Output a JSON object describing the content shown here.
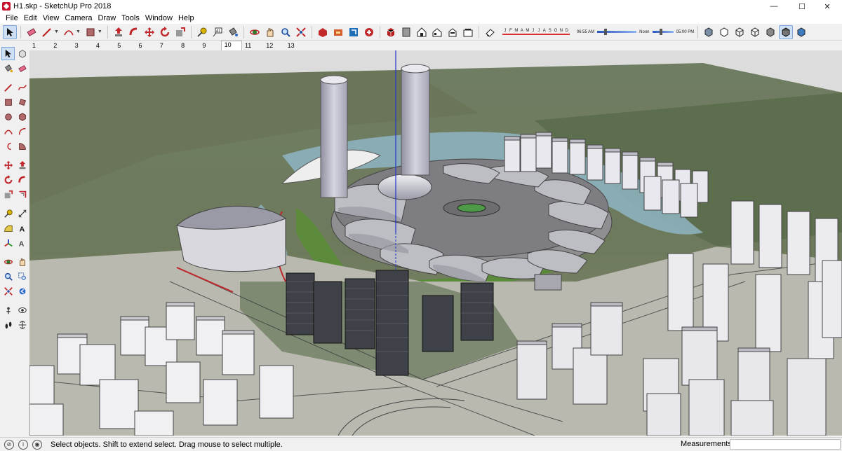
{
  "window": {
    "title": "H1.skp - SketchUp Pro 2018",
    "minimize": "—",
    "maximize": "☐",
    "close": "✕"
  },
  "menu": {
    "items": [
      "File",
      "Edit",
      "View",
      "Camera",
      "Draw",
      "Tools",
      "Window",
      "Help"
    ]
  },
  "toolbar": {
    "shadow_months": [
      "J",
      "F",
      "M",
      "A",
      "M",
      "J",
      "J",
      "A",
      "S",
      "O",
      "N",
      "D"
    ],
    "shadow_time_start": "06:55 AM",
    "shadow_time_mid": "Noon",
    "shadow_time_end": "05:00 PM"
  },
  "scenes": {
    "tabs": [
      "1",
      "2",
      "3",
      "4",
      "5",
      "6",
      "7",
      "8",
      "9",
      "10",
      "11",
      "12",
      "13"
    ],
    "active": "10"
  },
  "status": {
    "message": "Select objects. Shift to extend select. Drag mouse to select multiple.",
    "measurements_label": "Measurements",
    "measurements_value": ""
  },
  "colors": {
    "accent": "#cfe0f5",
    "sketchup_red": "#c8102e",
    "axis_blue": "#2233cc"
  }
}
